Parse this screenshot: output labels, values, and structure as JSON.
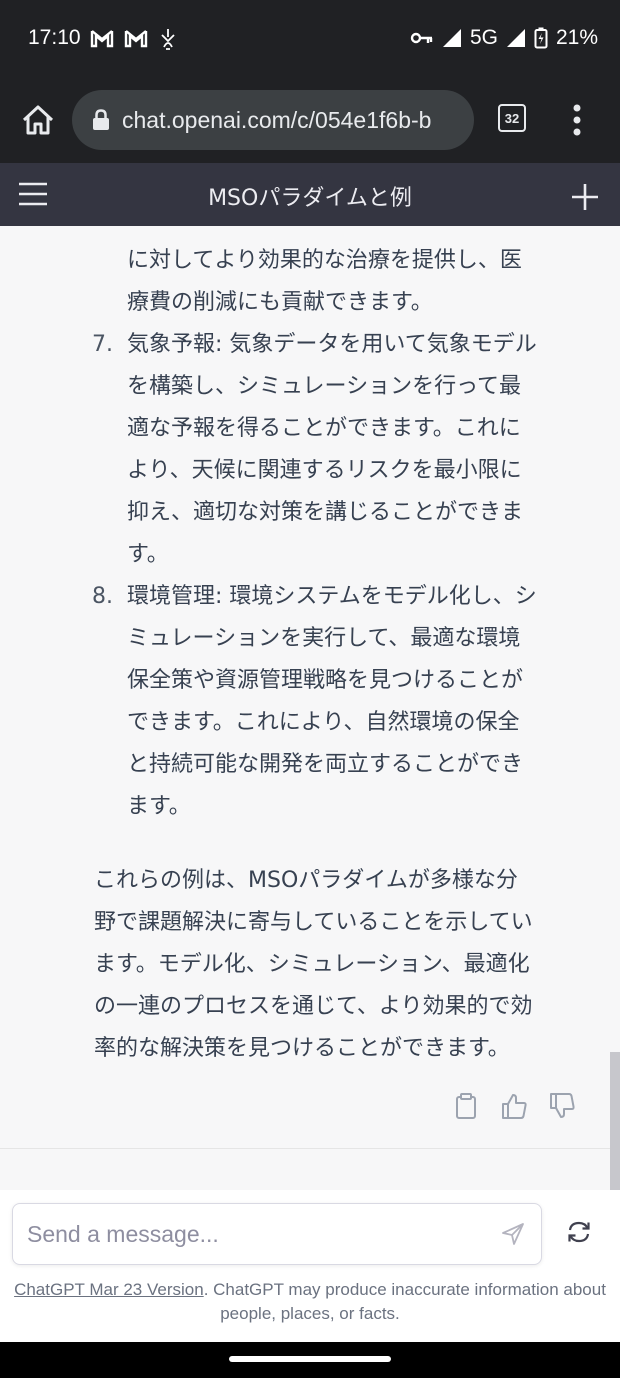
{
  "status_bar": {
    "time": "17:10",
    "network": "5G",
    "battery": "21%"
  },
  "browser": {
    "url": "chat.openai.com/c/054e1f6b-b",
    "tab_count": "32"
  },
  "chat": {
    "title": "MSOパラダイムと例",
    "list": [
      {
        "number": "",
        "lines": [
          "に対してより効果的な治療を提供し、医",
          "療費の削減にも貢献できます。"
        ]
      },
      {
        "number": "7.",
        "lines": [
          "気象予報: 気象データを用いて気象モデル",
          "を構築し、シミュレーションを行って最",
          "適な予報を得ることができます。これに",
          "より、天候に関連するリスクを最小限に",
          "抑え、適切な対策を講じることができま",
          "す。"
        ]
      },
      {
        "number": "8.",
        "lines": [
          "環境管理: 環境システムをモデル化し、シ",
          "ミュレーションを実行して、最適な環境",
          "保全策や資源管理戦略を見つけることが",
          "できます。これにより、自然環境の保全",
          "と持続可能な開発を両立することができ",
          "ます。"
        ]
      }
    ],
    "summary_lines": [
      "これらの例は、MSOパラダイムが多様な分",
      "野で課題解決に寄与していることを示してい",
      "ます。モデル化、シミュレーション、最適化",
      "の一連のプロセスを通じて、より効果的で効",
      "率的な解決策を見つけることができます。"
    ]
  },
  "composer": {
    "placeholder": "Send a message..."
  },
  "disclaimer": {
    "link_text": "ChatGPT Mar 23 Version",
    "text": ". ChatGPT may produce inaccurate information about people, places, or facts."
  }
}
